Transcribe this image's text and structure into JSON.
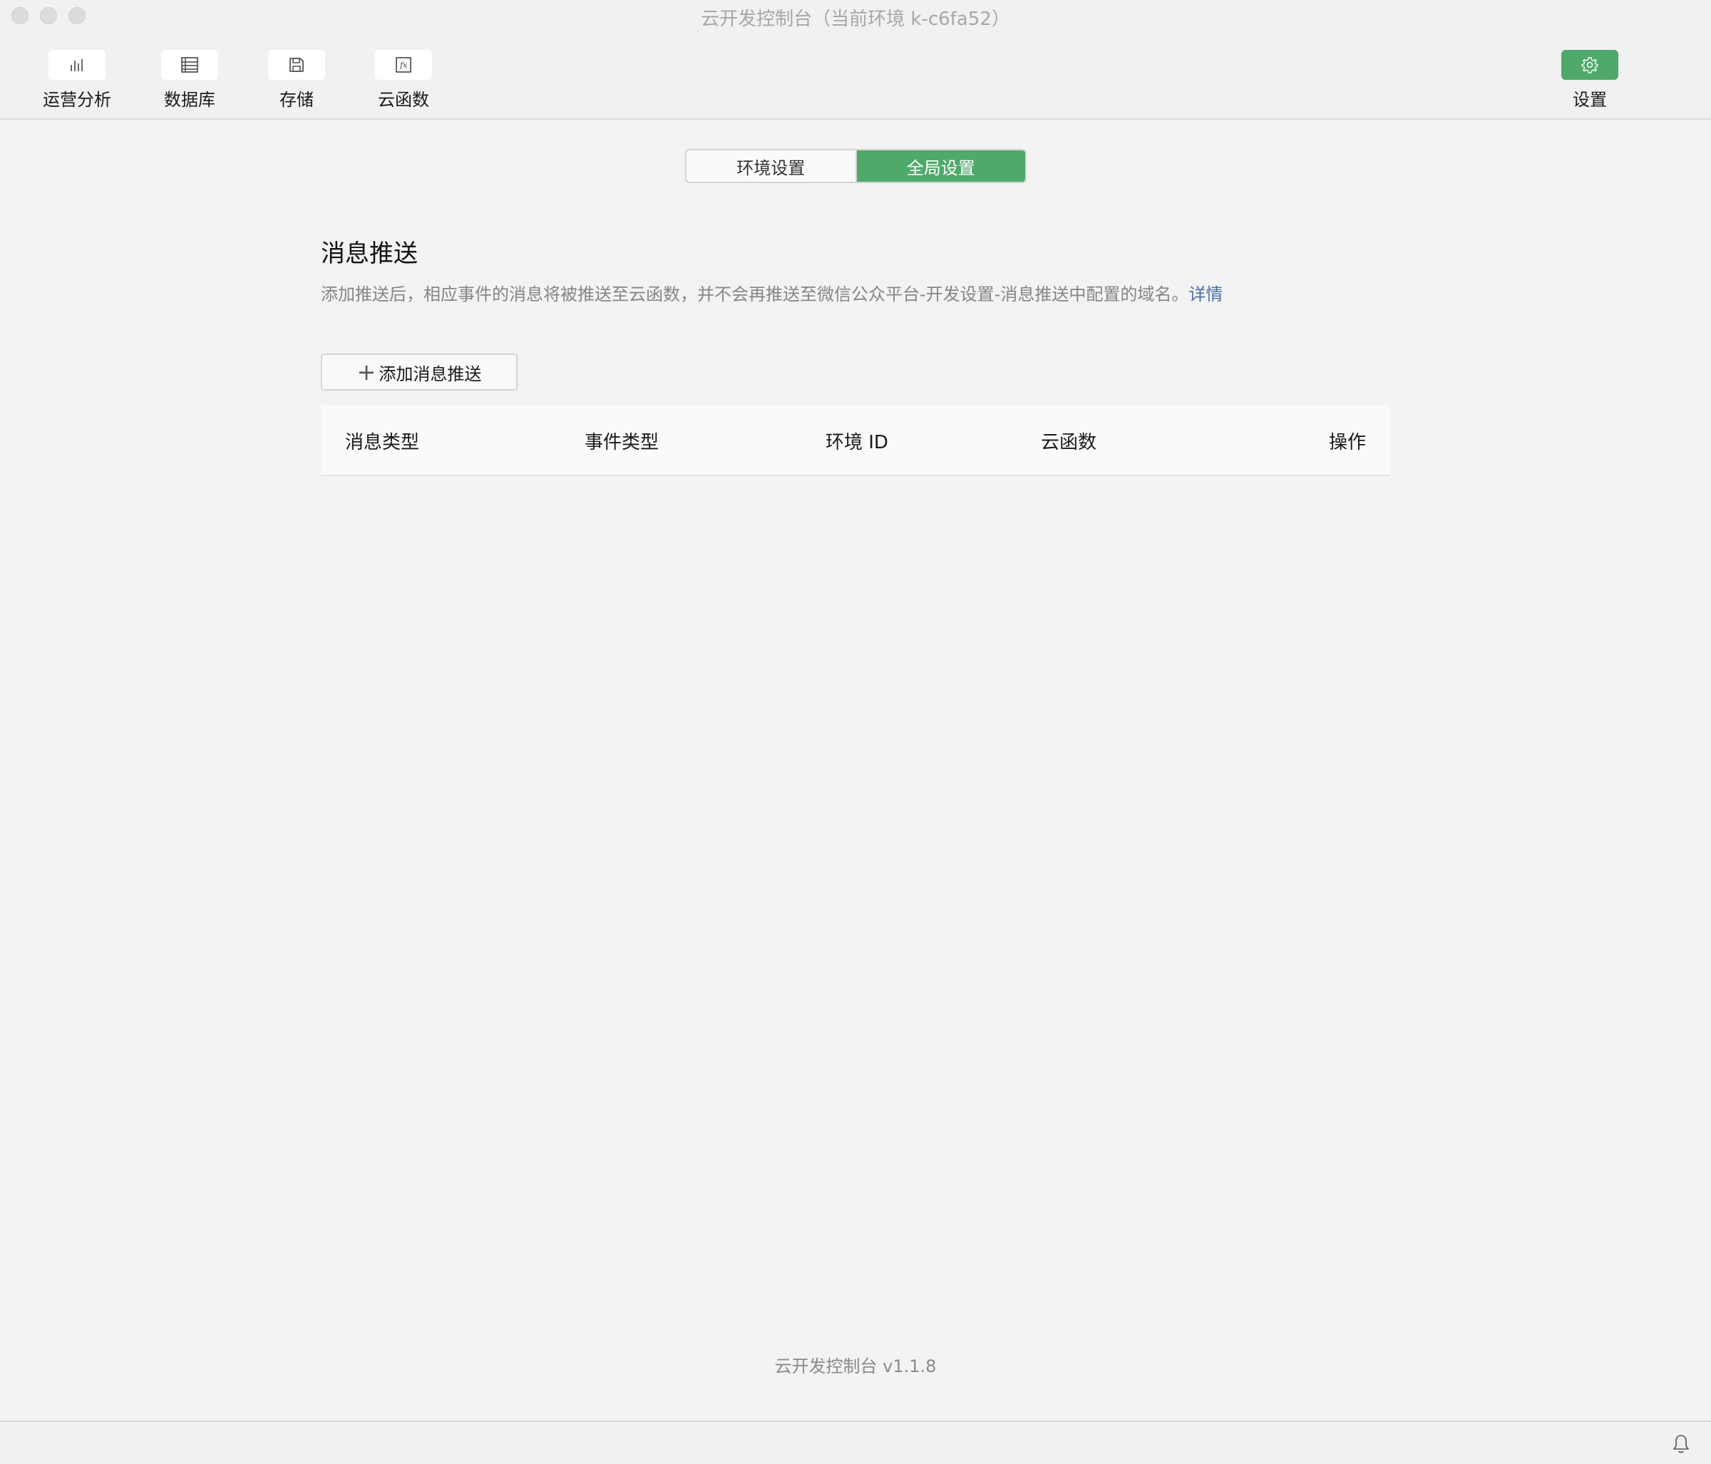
{
  "window": {
    "title": "云开发控制台（当前环境 k-c6fa52）"
  },
  "toolbar": {
    "items": [
      {
        "label": "运营分析",
        "icon": "bar-chart-icon"
      },
      {
        "label": "数据库",
        "icon": "database-icon"
      },
      {
        "label": "存储",
        "icon": "save-disk-icon"
      },
      {
        "label": "云函数",
        "icon": "function-fx-icon"
      }
    ],
    "settings": {
      "label": "设置",
      "icon": "gear-icon",
      "active_color": "#4fa96b"
    }
  },
  "tabs": [
    {
      "label": "环境设置",
      "active": false
    },
    {
      "label": "全局设置",
      "active": true
    }
  ],
  "section": {
    "title": "消息推送",
    "description": "添加推送后，相应事件的消息将被推送至云函数，并不会再推送至微信公众平台-开发设置-消息推送中配置的域名。",
    "link": "详情",
    "add_button": "添加消息推送"
  },
  "table": {
    "columns": [
      "消息类型",
      "事件类型",
      "环境 ID",
      "云函数",
      "操作"
    ]
  },
  "footer": {
    "version": "云开发控制台 v1.1.8"
  },
  "colors": {
    "accent": "#4fa96b",
    "link": "#4a6fa5"
  }
}
